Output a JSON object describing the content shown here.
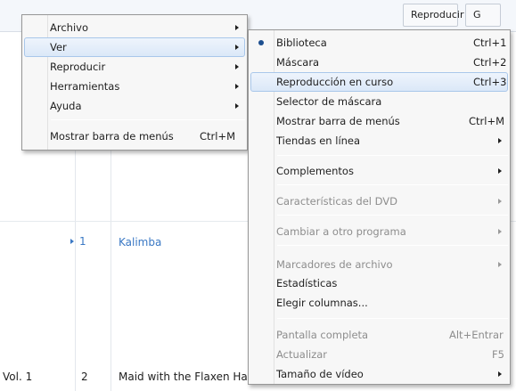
{
  "background": {
    "tabs": [
      "Reproducir",
      "G"
    ],
    "rows": [
      {
        "number": "1",
        "title": "Kalimba",
        "playing": true
      },
      {
        "album": "Vol. 1",
        "number": "2",
        "title": "Maid with the Flaxen Hair"
      }
    ]
  },
  "main_menu": {
    "items": [
      {
        "label": "Archivo",
        "submenu": true
      },
      {
        "label": "Ver",
        "submenu": true,
        "highlighted": true
      },
      {
        "label": "Reproducir",
        "submenu": true
      },
      {
        "label": "Herramientas",
        "submenu": true
      },
      {
        "label": "Ayuda",
        "submenu": true
      },
      {
        "label": "Mostrar barra de menús",
        "shortcut": "Ctrl+M"
      }
    ]
  },
  "view_menu": {
    "items": [
      {
        "label": "Biblioteca",
        "shortcut": "Ctrl+1",
        "checked": true
      },
      {
        "label": "Máscara",
        "shortcut": "Ctrl+2"
      },
      {
        "label": "Reproducción en curso",
        "shortcut": "Ctrl+3",
        "highlighted": true
      },
      {
        "label": "Selector de máscara"
      },
      {
        "label": "Mostrar barra de menús",
        "shortcut": "Ctrl+M"
      },
      {
        "label": "Tiendas en línea",
        "submenu": true
      },
      {
        "label": "Complementos",
        "submenu": true
      },
      {
        "label": "Características del DVD",
        "submenu": true,
        "disabled": true
      },
      {
        "label": "Cambiar a otro programa",
        "submenu": true,
        "disabled": true
      },
      {
        "label": "Marcadores de archivo",
        "submenu": true,
        "disabled": true
      },
      {
        "label": "Estadísticas"
      },
      {
        "label": "Elegir columnas..."
      },
      {
        "label": "Pantalla completa",
        "shortcut": "Alt+Entrar",
        "disabled": true
      },
      {
        "label": "Actualizar",
        "shortcut": "F5",
        "disabled": true
      },
      {
        "label": "Tamaño de vídeo",
        "submenu": true
      }
    ]
  }
}
